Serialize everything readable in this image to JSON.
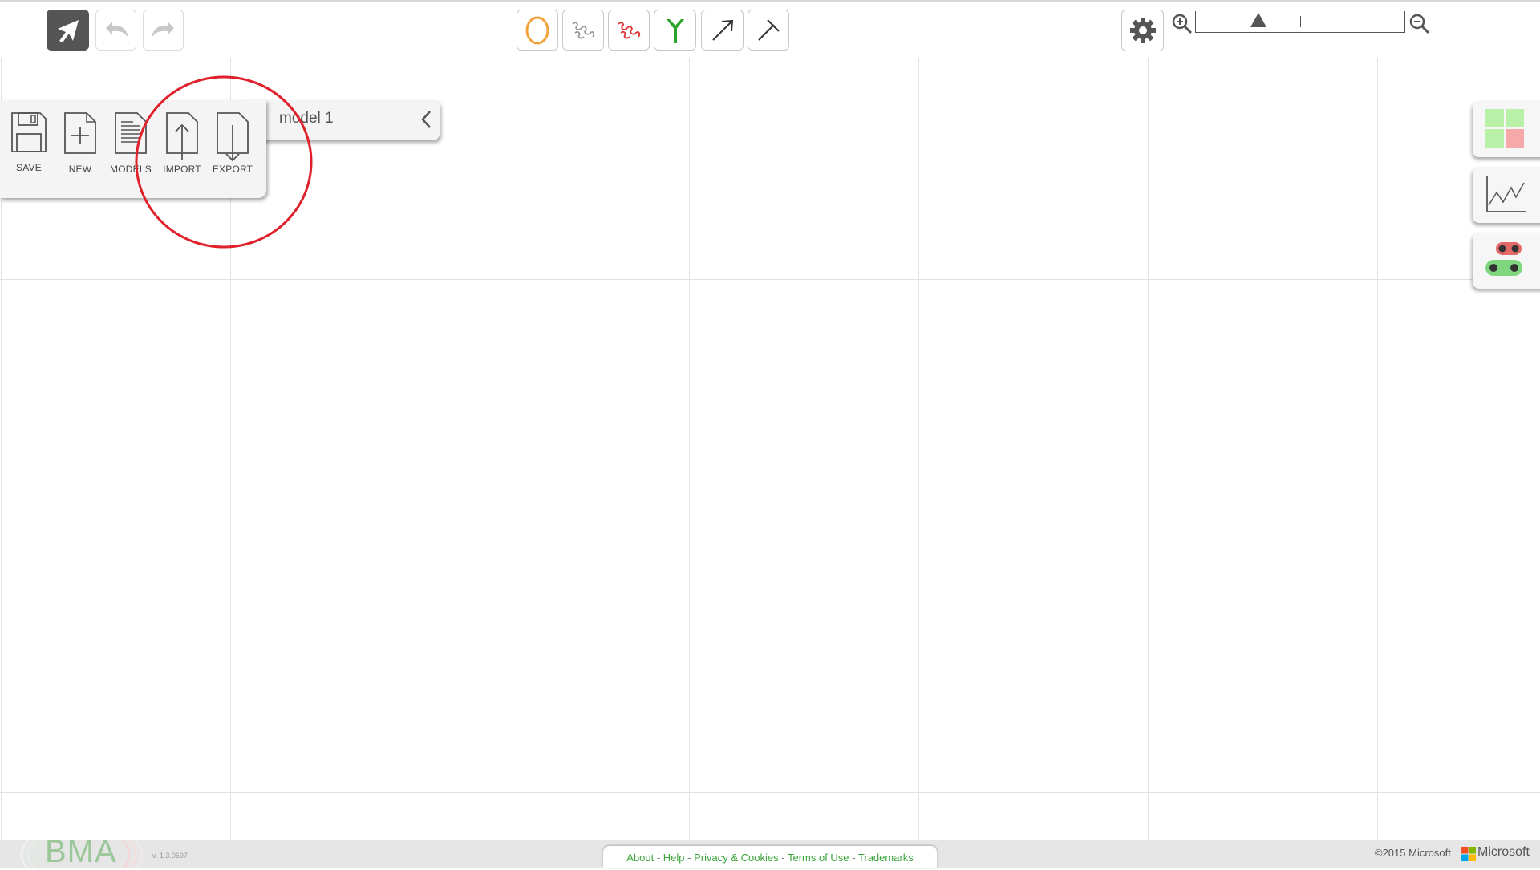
{
  "file_menu": {
    "buttons": [
      {
        "id": "save",
        "label": "SAVE"
      },
      {
        "id": "new",
        "label": "NEW"
      },
      {
        "id": "models",
        "label": "MODELS"
      },
      {
        "id": "import",
        "label": "IMPORT"
      },
      {
        "id": "export",
        "label": "EXPORT"
      }
    ],
    "model_name": "model 1"
  },
  "toolbar": {
    "left": [
      "pointer-icon",
      "undo-icon",
      "redo-icon"
    ],
    "elements": [
      "cell-icon",
      "variable-icon",
      "constant-variable-icon",
      "receptor-icon",
      "activator-arrow-icon",
      "inhibitor-arrow-icon"
    ],
    "right": [
      "settings-icon",
      "zoom-in-icon",
      "zoom-out-icon"
    ]
  },
  "zoom": {
    "level_fraction": 0.3
  },
  "side_panels": [
    "proof-analysis-icon",
    "simulation-icon",
    "further-testing-icon"
  ],
  "footer": {
    "links": [
      "About",
      "Help",
      "Privacy & Cookies",
      "Terms of Use",
      "Trademarks"
    ],
    "separator": "-",
    "version": "v. 1.3.0697",
    "copyright": "©2015 Microsoft",
    "company": "Microsoft",
    "logo_text": "BMA"
  },
  "colors": {
    "accent_green": "#3aa43a",
    "cell_orange": "#f2a23a",
    "constant_red": "#e03030",
    "annotation_red": "#e0202a"
  }
}
